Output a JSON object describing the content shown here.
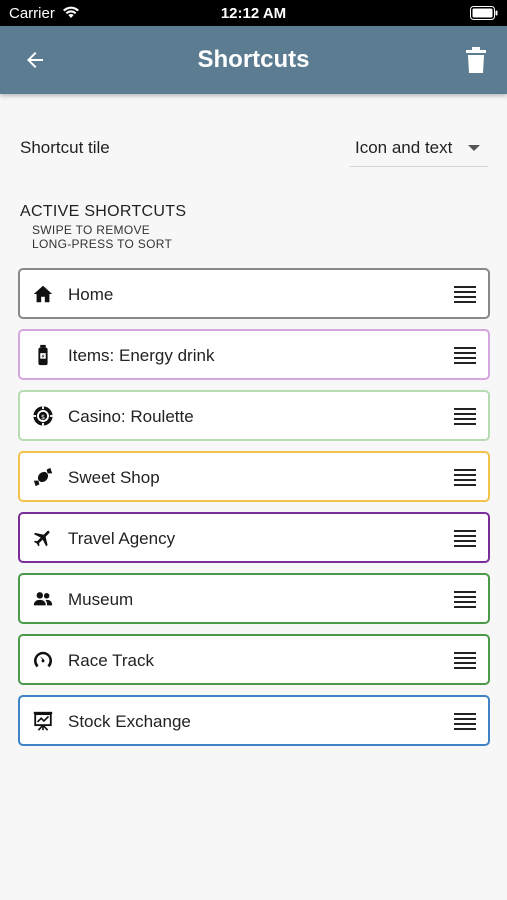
{
  "status_bar": {
    "carrier": "Carrier",
    "time": "12:12 AM"
  },
  "app_bar": {
    "title": "Shortcuts",
    "back_icon": "arrow-left-icon",
    "delete_icon": "trash-icon",
    "color": "#5b7c91"
  },
  "settings": {
    "tile_label": "Shortcut tile",
    "tile_value": "Icon and text"
  },
  "section": {
    "title": "ACTIVE SHORTCUTS",
    "hint1": "SWIPE TO REMOVE",
    "hint2": "LONG-PRESS TO SORT"
  },
  "shortcuts": [
    {
      "label": "Home",
      "icon": "home-icon",
      "border": "#888888"
    },
    {
      "label": "Items: Energy drink",
      "icon": "energy-drink-icon",
      "border": "#d6a6df"
    },
    {
      "label": "Casino: Roulette",
      "icon": "roulette-icon",
      "border": "#b7dcb4"
    },
    {
      "label": "Sweet Shop",
      "icon": "candy-icon",
      "border": "#f2c14e"
    },
    {
      "label": "Travel Agency",
      "icon": "airplane-icon",
      "border": "#7b2d9a"
    },
    {
      "label": "Museum",
      "icon": "museum-icon",
      "border": "#4a9a4a"
    },
    {
      "label": "Race Track",
      "icon": "speedometer-icon",
      "border": "#4a9a4a"
    },
    {
      "label": "Stock Exchange",
      "icon": "stock-chart-icon",
      "border": "#3f83c6"
    }
  ]
}
